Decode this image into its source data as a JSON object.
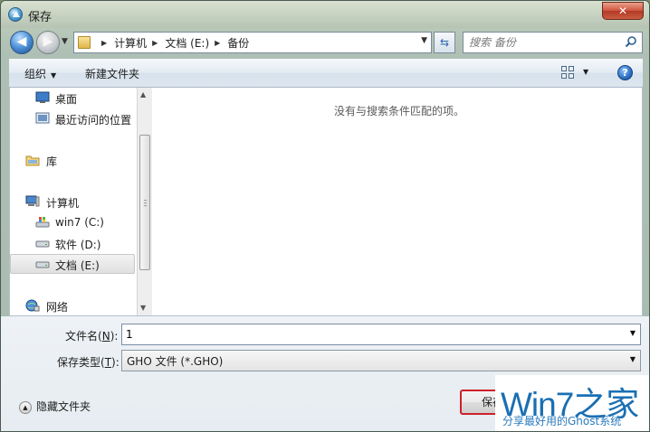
{
  "window": {
    "title": "保存",
    "close_label": "✕"
  },
  "address_bar": {
    "breadcrumbs": [
      "计算机",
      "文档 (E:)",
      "备份"
    ],
    "search_placeholder": "搜索 备份"
  },
  "toolbar": {
    "organize_label": "组织",
    "new_folder_label": "新建文件夹",
    "help_label": "?"
  },
  "nav_pane": {
    "items": [
      {
        "label": "桌面",
        "icon": "desktop-icon"
      },
      {
        "label": "最近访问的位置",
        "icon": "recent-places-icon"
      },
      {
        "label": "库",
        "icon": "library-icon"
      },
      {
        "label": "计算机",
        "icon": "computer-icon"
      },
      {
        "label": "win7 (C:)",
        "icon": "system-drive-icon"
      },
      {
        "label": "软件 (D:)",
        "icon": "drive-icon"
      },
      {
        "label": "文档 (E:)",
        "icon": "drive-icon",
        "selected": true
      },
      {
        "label": "网络",
        "icon": "network-icon"
      }
    ]
  },
  "file_pane": {
    "empty_message": "没有与搜索条件匹配的项。"
  },
  "form": {
    "filename_label": "文件名",
    "filename_hotkey": "N",
    "filename_value": "1",
    "filetype_label": "保存类型",
    "filetype_hotkey": "T",
    "filetype_value": "GHO 文件 (*.GHO)",
    "hide_folders_label": "隐藏文件夹",
    "save_label": "保存"
  },
  "watermark": {
    "main": "Win7之家",
    "sub": "分享最好用的Ghost系统"
  }
}
